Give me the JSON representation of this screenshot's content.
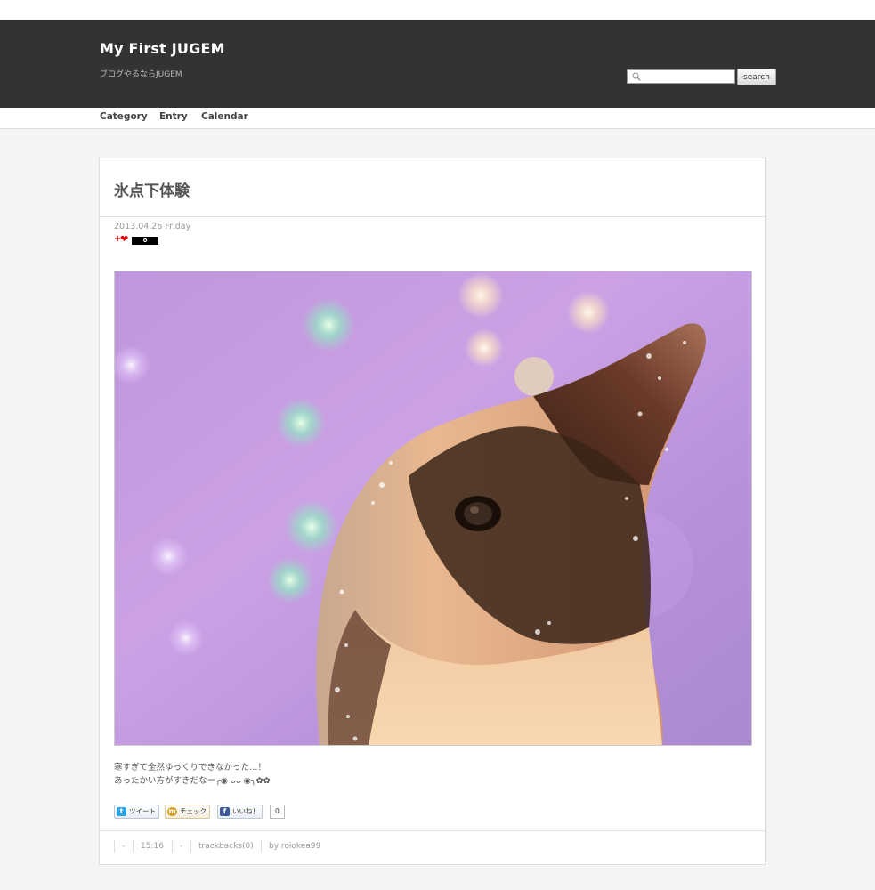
{
  "header": {
    "site_title": "My First JUGEM",
    "site_description": "ブログやるならJUGEM",
    "search": {
      "placeholder": "",
      "button_label": "search",
      "icon": "search-icon"
    }
  },
  "nav": {
    "items": [
      {
        "label": "Category"
      },
      {
        "label": "Entry"
      },
      {
        "label": "Calendar"
      }
    ]
  },
  "entry": {
    "title": "氷点下体験",
    "date": "2013.04.26 Friday",
    "vote": {
      "plus": "+",
      "heart": "❤",
      "count": "0"
    },
    "photo": {
      "icon": "penguin-photo"
    },
    "body_lines": [
      "寒すぎて全然ゆっくりできなかった…！",
      "あったかい方がすきだなー╭◉ ᴗᴗ ◉╮✿✿"
    ],
    "share": {
      "tweet_label": "ツイート",
      "check_label": "チェック",
      "like_label": "いいね！",
      "like_count": "0"
    },
    "footer": {
      "category": "-",
      "time": "15:16",
      "comments": "-",
      "trackbacks": "trackbacks(0)",
      "author": "by roiokea99"
    }
  },
  "colors": {
    "header_bg": "#333333",
    "page_bg": "#f4f4f4",
    "card_bg": "#ffffff"
  }
}
